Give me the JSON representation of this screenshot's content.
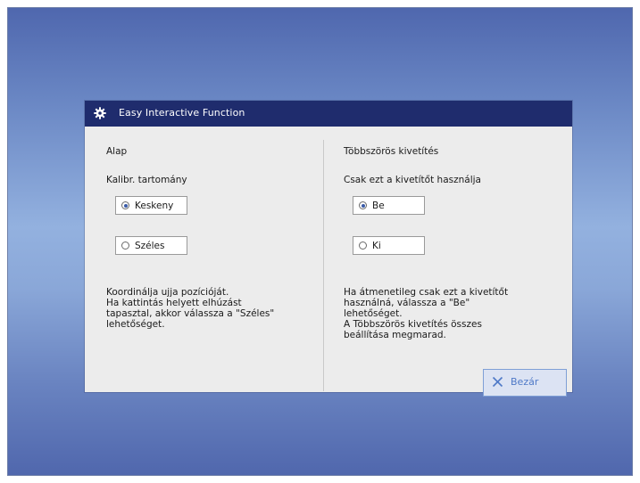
{
  "dialog": {
    "title": "Easy Interactive Function",
    "title_icon": "gear-icon"
  },
  "left": {
    "heading": "Alap",
    "subheading": "Kalibr. tartomány",
    "options": [
      {
        "label": "Keskeny",
        "selected": true
      },
      {
        "label": "Széles",
        "selected": false
      }
    ],
    "description": [
      "Koordinálja ujja pozícióját.",
      "Ha kattintás helyett elhúzást",
      "tapasztal, akkor válassza a \"Széles\"",
      "lehetőséget."
    ]
  },
  "right": {
    "heading": "Többszörös kivetítés",
    "subheading": "Csak ezt a kivetítőt használja",
    "options": [
      {
        "label": "Be",
        "selected": true
      },
      {
        "label": "Ki",
        "selected": false
      }
    ],
    "description": [
      "Ha átmenetileg csak ezt a kivetítőt",
      "használná, válassza a \"Be\"",
      "lehetőséget.",
      "A Többszörös kivetítés összes",
      "beállítása megmarad."
    ]
  },
  "close_button": {
    "label": "Bezár",
    "icon": "close-icon"
  },
  "colors": {
    "titlebar": "#1f2c6d",
    "accent": "#4f79c7"
  }
}
